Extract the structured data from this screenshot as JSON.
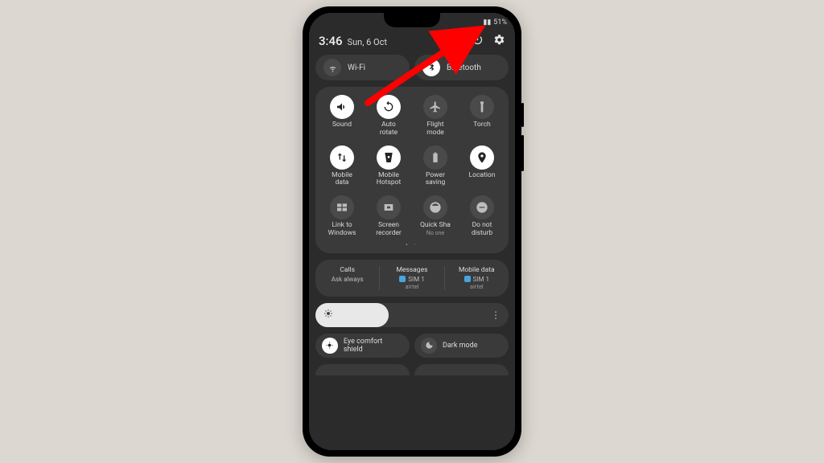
{
  "status": {
    "battery": "51%"
  },
  "header": {
    "time": "3:46",
    "date": "Sun, 6 Oct",
    "icons": {
      "edit": "edit-icon",
      "power": "power-icon",
      "settings": "settings-icon"
    }
  },
  "big_toggles": [
    {
      "name": "wifi",
      "label": "Wi-Fi",
      "on": false
    },
    {
      "name": "bluetooth",
      "label": "Bluetooth",
      "on": true
    }
  ],
  "tiles": [
    {
      "name": "sound",
      "label": "Sound",
      "icon": "volume-icon",
      "on": true
    },
    {
      "name": "auto-rotate",
      "label": "Auto\nrotate",
      "icon": "rotate-icon",
      "on": true
    },
    {
      "name": "flight-mode",
      "label": "Flight\nmode",
      "icon": "airplane-icon",
      "on": false
    },
    {
      "name": "torch",
      "label": "Torch",
      "icon": "torch-icon",
      "on": false
    },
    {
      "name": "mobile-data",
      "label": "Mobile\ndata",
      "icon": "data-arrows-icon",
      "on": true
    },
    {
      "name": "mobile-hotspot",
      "label": "Mobile\nHotspot",
      "icon": "hotspot-icon",
      "on": true
    },
    {
      "name": "power-saving",
      "label": "Power\nsaving",
      "icon": "battery-icon",
      "on": false
    },
    {
      "name": "location",
      "label": "Location",
      "icon": "location-pin-icon",
      "on": true
    },
    {
      "name": "link-to-windows",
      "label": "Link to\nWindows",
      "icon": "windows-icon",
      "on": false
    },
    {
      "name": "screen-recorder",
      "label": "Screen\nrecorder",
      "icon": "record-icon",
      "on": false
    },
    {
      "name": "quick-share",
      "label": "Quick Sha",
      "sub": "No one",
      "icon": "share-icon",
      "on": false
    },
    {
      "name": "do-not-disturb",
      "label": "Do not\ndisturb",
      "icon": "dnd-icon",
      "on": false
    }
  ],
  "sim": {
    "calls": {
      "title": "Calls",
      "value": "Ask always",
      "chip": false
    },
    "messages": {
      "title": "Messages",
      "value": "SIM 1",
      "carrier": "airtel",
      "chip": true
    },
    "data": {
      "title": "Mobile data",
      "value": "SIM 1",
      "carrier": "airtel",
      "chip": true
    }
  },
  "brightness": {
    "percent": 38
  },
  "extras": [
    {
      "name": "eye-comfort",
      "label": "Eye comfort shield",
      "icon": "eye-comfort-icon",
      "on": true
    },
    {
      "name": "dark-mode",
      "label": "Dark mode",
      "icon": "moon-icon",
      "on": false
    }
  ],
  "annotation": {
    "target": "power-icon",
    "color": "#ff0000"
  }
}
